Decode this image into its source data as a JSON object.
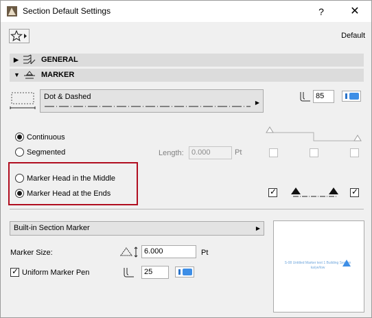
{
  "window": {
    "title": "Section Default Settings",
    "help_label": "?",
    "close_label": "✕",
    "favorites_icon": "star-icon",
    "default_label": "Default"
  },
  "sections": {
    "general": {
      "label": "GENERAL",
      "expanded": false
    },
    "marker": {
      "label": "MARKER",
      "expanded": true
    }
  },
  "line": {
    "type_name": "Dot & Dashed",
    "pen_number": "85",
    "pen_color": "#3d8ee6"
  },
  "style": {
    "continuous_label": "Continuous",
    "segmented_label": "Segmented",
    "selected": "continuous",
    "length_label": "Length:",
    "length_value": "0.000",
    "length_unit": "Pt"
  },
  "marker_head": {
    "middle_label": "Marker Head in the Middle",
    "ends_label": "Marker Head at the Ends",
    "selected": "ends",
    "left_end_checked": true,
    "right_end_checked": true
  },
  "marker_type": {
    "name": "Built-in Section Marker",
    "size_label": "Marker Size:",
    "size_value": "6.000",
    "size_unit": "Pt",
    "uniform_pen_label": "Uniform Marker Pen",
    "uniform_pen_checked": true,
    "pen_number": "25",
    "pen_color": "#3d8ee6"
  },
  "preview": {
    "text": "S-08 Untitled Marker text 1 Building Section ka/ye/low",
    "accent": "#3d8ee6"
  }
}
